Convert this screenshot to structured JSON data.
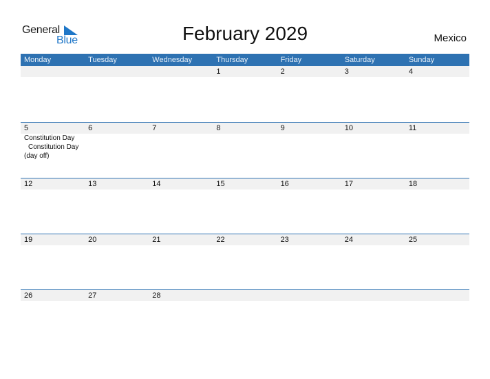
{
  "logo": {
    "word1": "General",
    "word2": "Blue",
    "accent_color": "#1f77c8"
  },
  "header": {
    "title": "February 2029",
    "country": "Mexico"
  },
  "calendar": {
    "weekdays": [
      "Monday",
      "Tuesday",
      "Wednesday",
      "Thursday",
      "Friday",
      "Saturday",
      "Sunday"
    ],
    "header_color": "#2e72b2",
    "weeks": [
      {
        "days": [
          "",
          "",
          "",
          "1",
          "2",
          "3",
          "4"
        ]
      },
      {
        "days": [
          "5",
          "6",
          "7",
          "8",
          "9",
          "10",
          "11"
        ]
      },
      {
        "days": [
          "12",
          "13",
          "14",
          "15",
          "16",
          "17",
          "18"
        ]
      },
      {
        "days": [
          "19",
          "20",
          "21",
          "22",
          "23",
          "24",
          "25"
        ]
      },
      {
        "days": [
          "26",
          "27",
          "28",
          "",
          "",
          "",
          ""
        ]
      }
    ],
    "events": {
      "line1": "Constitution Day",
      "line2": "Constitution Day",
      "line3": "(day off)"
    }
  }
}
